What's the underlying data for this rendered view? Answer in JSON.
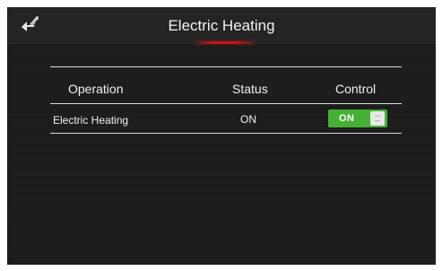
{
  "header": {
    "title": "Electric Heating",
    "back_icon": "back-arrow-icon"
  },
  "table": {
    "columns": [
      "Operation",
      "Status",
      "Control"
    ],
    "rows": [
      {
        "operation": "Electric Heating",
        "status": "ON",
        "control": "ON",
        "control_on": true
      }
    ]
  },
  "colors": {
    "screen_bg": "#1c1c1c",
    "accent": "#c41818",
    "toggle_on": "#45b134",
    "text": "#f0f0f0"
  }
}
